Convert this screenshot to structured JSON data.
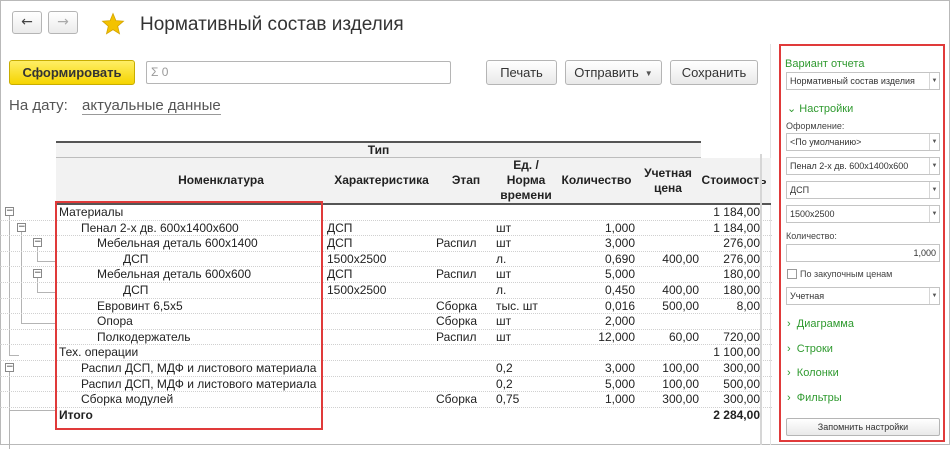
{
  "window": {
    "title": "Нормативный состав изделия",
    "back_icon": "←",
    "forward_icon": "→"
  },
  "toolbar": {
    "generate_label": "Сформировать",
    "sum_placeholder": "Σ 0",
    "print_label": "Печать",
    "send_label": "Отправить",
    "save_label": "Сохранить"
  },
  "date": {
    "label": "На дату:",
    "value": "актуальные данные"
  },
  "report": {
    "type_header": "Тип",
    "columns": {
      "nomenclature": "Номенклатура",
      "characteristic": "Характеристика",
      "stage": "Этап",
      "unit": "Ед. / Норма времени",
      "quantity": "Количество",
      "price": "Учетная цена",
      "cost": "Стоимость"
    },
    "rows": [
      {
        "name": "Материалы",
        "level": 0,
        "char": "",
        "stage": "",
        "unit": "",
        "qty": "",
        "price": "",
        "cost": "1 184,00"
      },
      {
        "name": "Пенал 2-х дв. 600х1400х600",
        "level": 1,
        "char": "ДСП",
        "stage": "",
        "unit": "шт",
        "qty": "1,000",
        "price": "",
        "cost": "1 184,00"
      },
      {
        "name": "Мебельная деталь 600х1400",
        "level": 2,
        "char": "ДСП",
        "stage": "Распил",
        "unit": "шт",
        "qty": "3,000",
        "price": "",
        "cost": "276,00"
      },
      {
        "name": "ДСП",
        "level": 3,
        "char": "1500х2500",
        "stage": "",
        "unit": "л.",
        "qty": "0,690",
        "price": "400,00",
        "cost": "276,00"
      },
      {
        "name": "Мебельная деталь 600х600",
        "level": 2,
        "char": "ДСП",
        "stage": "Распил",
        "unit": "шт",
        "qty": "5,000",
        "price": "",
        "cost": "180,00"
      },
      {
        "name": "ДСП",
        "level": 3,
        "char": "1500х2500",
        "stage": "",
        "unit": "л.",
        "qty": "0,450",
        "price": "400,00",
        "cost": "180,00"
      },
      {
        "name": "Евровинт 6,5х5",
        "level": 2,
        "char": "",
        "stage": "Сборка",
        "unit": "тыс. шт",
        "qty": "0,016",
        "price": "500,00",
        "cost": "8,00"
      },
      {
        "name": "Опора",
        "level": 2,
        "char": "",
        "stage": "Сборка",
        "unit": "шт",
        "qty": "2,000",
        "price": "",
        "cost": ""
      },
      {
        "name": "Полкодержатель",
        "level": 2,
        "char": "",
        "stage": "Распил",
        "unit": "шт",
        "qty": "12,000",
        "price": "60,00",
        "cost": "720,00"
      },
      {
        "name": "Тех. операции",
        "level": 0,
        "char": "",
        "stage": "",
        "unit": "",
        "qty": "",
        "price": "",
        "cost": "1 100,00"
      },
      {
        "name": "Распил ДСП, МДФ и листового материала",
        "level": 1,
        "char": "",
        "stage": "",
        "unit": "0,2",
        "qty": "3,000",
        "price": "100,00",
        "cost": "300,00"
      },
      {
        "name": "Распил ДСП, МДФ и листового материала",
        "level": 1,
        "char": "",
        "stage": "",
        "unit": "0,2",
        "qty": "5,000",
        "price": "100,00",
        "cost": "500,00"
      },
      {
        "name": "Сборка модулей",
        "level": 1,
        "char": "",
        "stage": "Сборка",
        "unit": "0,75",
        "qty": "1,000",
        "price": "300,00",
        "cost": "300,00"
      }
    ],
    "total": {
      "name": "Итого",
      "cost": "2 284,00"
    }
  },
  "settings": {
    "title": "Вариант отчета",
    "variant": "Нормативный состав изделия",
    "settings_group": "Настройки",
    "design_label": "Оформление:",
    "design_value": "<По умолчанию>",
    "product_value": "Пенал 2-х дв. 600х1400х600",
    "material_value": "ДСП",
    "size_value": "1500х2500",
    "quantity_label": "Количество:",
    "quantity_value": "1,000",
    "purchase_prices_label": "По закупочным ценам",
    "price_type_value": "Учетная",
    "groups": [
      "Диаграмма",
      "Строки",
      "Колонки",
      "Фильтры"
    ],
    "remember_label": "Запомнить настройки"
  },
  "colors": {
    "accent_green": "#2f9a2f",
    "highlight_red": "#e03a3a",
    "primary_yellow": "#f5d400"
  }
}
